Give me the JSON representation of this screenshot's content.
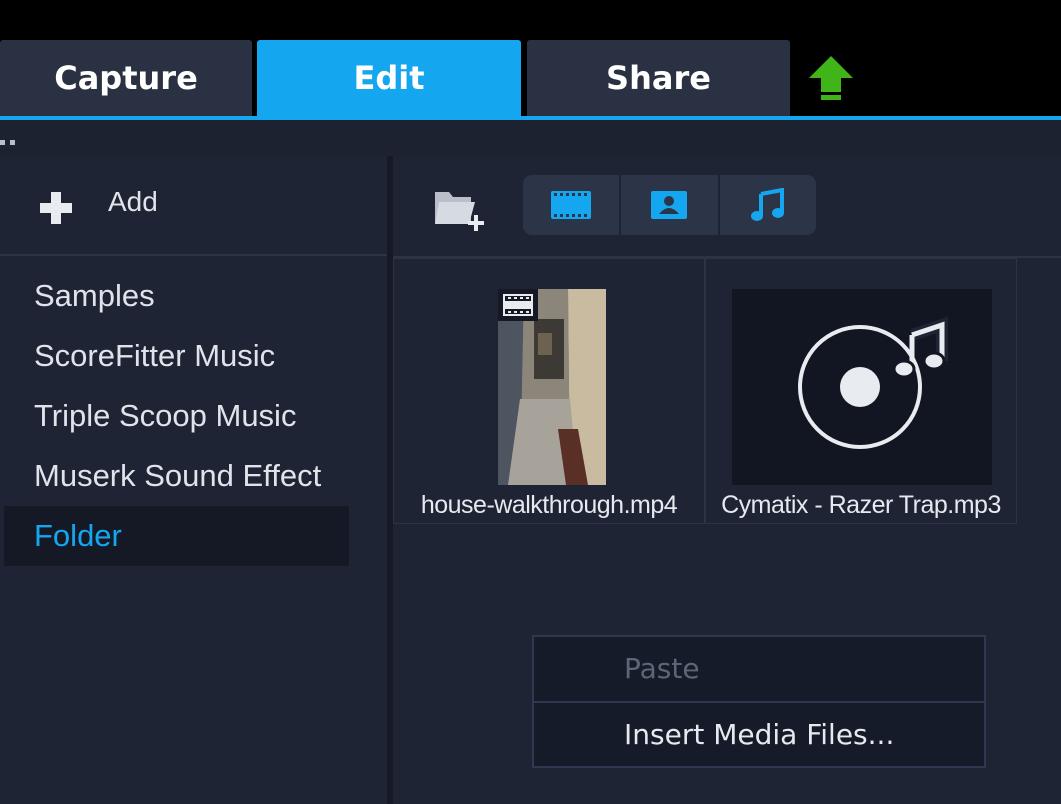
{
  "tabs": [
    {
      "label": "Capture",
      "active": false
    },
    {
      "label": "Edit",
      "active": true
    },
    {
      "label": "Share",
      "active": false
    }
  ],
  "colors": {
    "accent": "#14a7f0",
    "upload_arrow": "#3fb51a",
    "panel": "#1e2434"
  },
  "toolbar": {
    "upload_icon": "upload-arrow-icon"
  },
  "library": {
    "add_label": "Add",
    "add_icon": "plus-icon",
    "items": [
      {
        "label": "Samples",
        "selected": false
      },
      {
        "label": "ScoreFitter Music",
        "selected": false
      },
      {
        "label": "Triple Scoop Music",
        "selected": false
      },
      {
        "label": "Muserk Sound Effect",
        "selected": false
      },
      {
        "label": "Folder",
        "selected": true
      }
    ]
  },
  "media_toolbar": {
    "new_folder_icon": "folder-add-icon",
    "filters": [
      {
        "icon": "video-filter-icon"
      },
      {
        "icon": "photo-filter-icon"
      },
      {
        "icon": "music-filter-icon"
      }
    ]
  },
  "media": [
    {
      "label": "house-walkthrough.mp4",
      "type": "video"
    },
    {
      "label": "Cymatix - Razer Trap.mp3",
      "type": "audio"
    }
  ],
  "context_menu": {
    "items": [
      {
        "label": "Paste",
        "enabled": false
      },
      {
        "label": "Insert Media Files...",
        "enabled": true
      }
    ]
  }
}
